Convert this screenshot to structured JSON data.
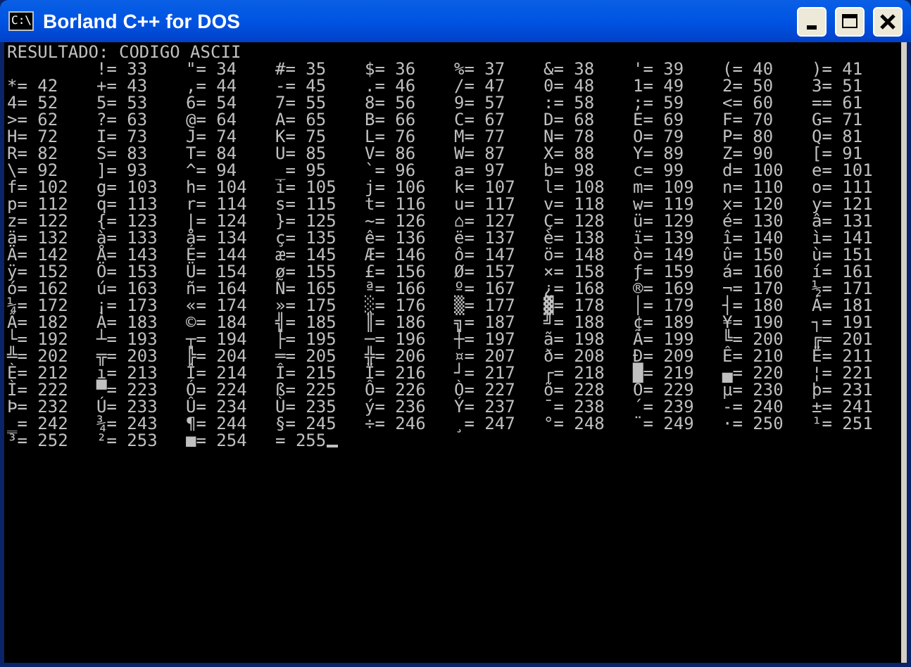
{
  "window": {
    "title": "Borland C++ for DOS",
    "icon_text": "C:\\"
  },
  "console": {
    "heading": "RESULTADO: CODIGO ASCII",
    "rows": [
      [
        "",
        "!= 33",
        "\"= 34",
        "#= 35",
        "$= 36",
        "%= 37",
        "&= 38",
        "'= 39",
        "(= 40",
        ")= 41"
      ],
      [
        "*= 42",
        "+= 43",
        ",= 44",
        "-= 45",
        ".= 46",
        "/= 47",
        "0= 48",
        "1= 49",
        "2= 50",
        "3= 51"
      ],
      [
        "4= 52",
        "5= 53",
        "6= 54",
        "7= 55",
        "8= 56",
        "9= 57",
        ":= 58",
        ";= 59",
        "<= 60",
        "== 61"
      ],
      [
        ">= 62",
        "?= 63",
        "@= 64",
        "A= 65",
        "B= 66",
        "C= 67",
        "D= 68",
        "E= 69",
        "F= 70",
        "G= 71"
      ],
      [
        "H= 72",
        "I= 73",
        "J= 74",
        "K= 75",
        "L= 76",
        "M= 77",
        "N= 78",
        "O= 79",
        "P= 80",
        "Q= 81"
      ],
      [
        "R= 82",
        "S= 83",
        "T= 84",
        "U= 85",
        "V= 86",
        "W= 87",
        "X= 88",
        "Y= 89",
        "Z= 90",
        "[= 91"
      ],
      [
        "\\= 92",
        "]= 93",
        "^= 94",
        "_= 95",
        "`= 96",
        "a= 97",
        "b= 98",
        "c= 99",
        "d= 100",
        "e= 101"
      ],
      [
        "f= 102",
        "g= 103",
        "h= 104",
        "i= 105",
        "j= 106",
        "k= 107",
        "l= 108",
        "m= 109",
        "n= 110",
        "o= 111"
      ],
      [
        "p= 112",
        "q= 113",
        "r= 114",
        "s= 115",
        "t= 116",
        "u= 117",
        "v= 118",
        "w= 119",
        "x= 120",
        "y= 121"
      ],
      [
        "z= 122",
        "{= 123",
        "|= 124",
        "}= 125",
        "~= 126",
        "⌂= 127",
        "Ç= 128",
        "ü= 129",
        "é= 130",
        "â= 131"
      ],
      [
        "ä= 132",
        "à= 133",
        "å= 134",
        "ç= 135",
        "ê= 136",
        "ë= 137",
        "è= 138",
        "ï= 139",
        "î= 140",
        "ì= 141"
      ],
      [
        "Ä= 142",
        "Å= 143",
        "É= 144",
        "æ= 145",
        "Æ= 146",
        "ô= 147",
        "ö= 148",
        "ò= 149",
        "û= 150",
        "ù= 151"
      ],
      [
        "ÿ= 152",
        "Ö= 153",
        "Ü= 154",
        "ø= 155",
        "£= 156",
        "Ø= 157",
        "×= 158",
        "ƒ= 159",
        "á= 160",
        "í= 161"
      ],
      [
        "ó= 162",
        "ú= 163",
        "ñ= 164",
        "Ñ= 165",
        "ª= 166",
        "º= 167",
        "¿= 168",
        "®= 169",
        "¬= 170",
        "½= 171"
      ],
      [
        "¼= 172",
        "¡= 173",
        "«= 174",
        "»= 175",
        "░= 176",
        "▒= 177",
        "▓= 178",
        "│= 179",
        "┤= 180",
        "Á= 181"
      ],
      [
        "Â= 182",
        "À= 183",
        "©= 184",
        "╣= 185",
        "║= 186",
        "╗= 187",
        "╝= 188",
        "¢= 189",
        "¥= 190",
        "┐= 191"
      ],
      [
        "└= 192",
        "┴= 193",
        "┬= 194",
        "├= 195",
        "─= 196",
        "┼= 197",
        "ã= 198",
        "Ã= 199",
        "╚= 200",
        "╔= 201"
      ],
      [
        "╩= 202",
        "╦= 203",
        "╠= 204",
        "═= 205",
        "╬= 206",
        "¤= 207",
        "ð= 208",
        "Ð= 209",
        "Ê= 210",
        "Ë= 211"
      ],
      [
        "È= 212",
        "ı= 213",
        "Í= 214",
        "Î= 215",
        "Ï= 216",
        "┘= 217",
        "┌= 218",
        "█= 219",
        "▄= 220",
        "¦= 221"
      ],
      [
        "Ì= 222",
        "▀= 223",
        "Ó= 224",
        "ß= 225",
        "Ô= 226",
        "Ò= 227",
        "õ= 228",
        "Õ= 229",
        "µ= 230",
        "þ= 231"
      ],
      [
        "Þ= 232",
        "Ú= 233",
        "Û= 234",
        "Ù= 235",
        "ý= 236",
        "Ý= 237",
        "¯= 238",
        "´= 239",
        "-= 240",
        "±= 241"
      ],
      [
        "‗= 242",
        "¾= 243",
        "¶= 244",
        "§= 245",
        "÷= 246",
        "¸= 247",
        "°= 248",
        "¨= 249",
        "·= 250",
        "¹= 251"
      ],
      [
        "³= 252",
        "²= 253",
        "■= 254",
        "= 255"
      ]
    ],
    "cursor": true
  }
}
